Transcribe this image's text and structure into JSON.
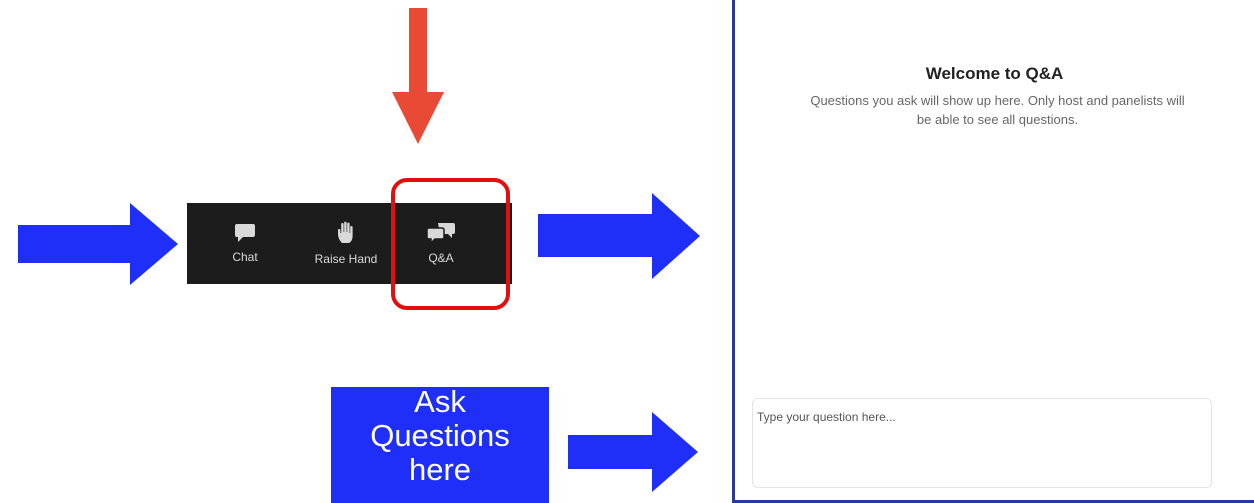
{
  "toolbar": {
    "items": [
      {
        "label": "Chat",
        "icon": "chat-bubble-icon"
      },
      {
        "label": "Raise Hand",
        "icon": "raise-hand-icon"
      },
      {
        "label": "Q&A",
        "icon": "qa-bubbles-icon"
      }
    ]
  },
  "annotation": {
    "ask_lines": [
      "Ask",
      "Questions",
      "here"
    ],
    "arrow_colors": {
      "red": "#e84a35",
      "blue": "#1f2ff7",
      "highlight": "#e30f0f"
    }
  },
  "qa_panel": {
    "title": "Welcome to Q&A",
    "description": "Questions you ask will show up here. Only host and panelists will be able to see all questions.",
    "input_placeholder": "Type your question here...",
    "input_value": ""
  }
}
